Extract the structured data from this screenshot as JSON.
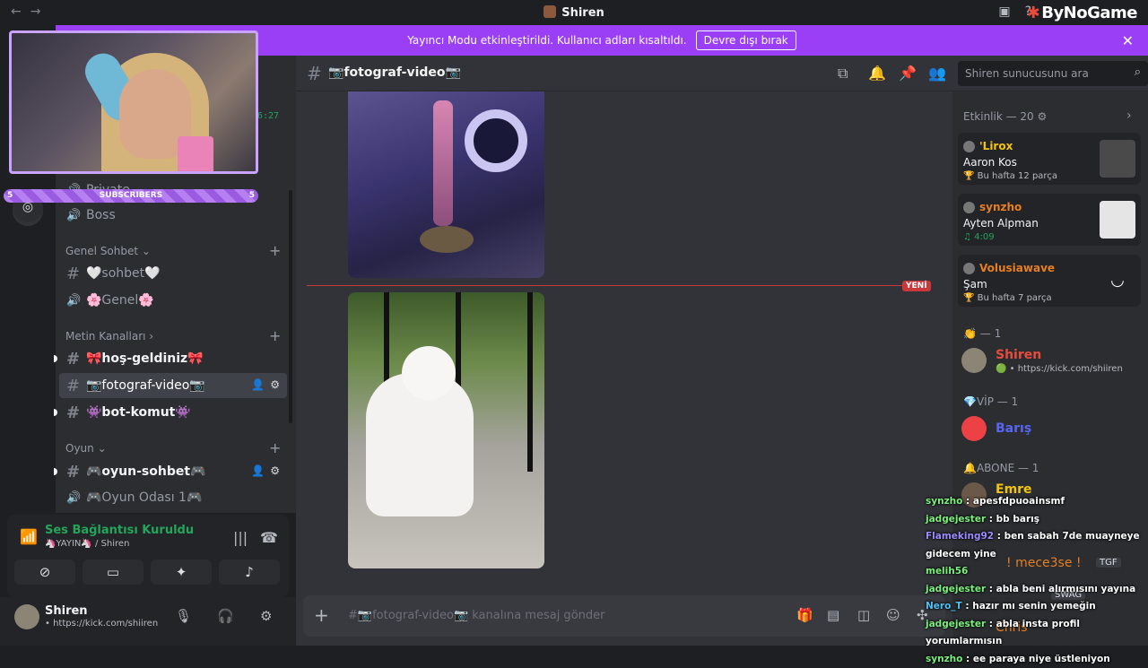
{
  "window": {
    "title": "Shiren",
    "brand": "ByNoGame"
  },
  "banner": {
    "text": "Yayıncı Modu etkinleştirildi. Kullanıcı adları kısaltıldı.",
    "button": "Devre dışı bırak"
  },
  "overlay": {
    "subscribers_label": "SUBSCRIBERS",
    "sub_left": "5",
    "sub_right": "5",
    "clock_fragment": "6:27"
  },
  "sidebar": {
    "channels": [
      {
        "name": "Private",
        "type": "voice"
      },
      {
        "name": "Boss",
        "type": "voice"
      }
    ],
    "categories": [
      {
        "label": "Genel Sohbet ⌄"
      },
      {
        "label": "Metin Kanalları ›"
      },
      {
        "label": "Oyun ⌄"
      }
    ],
    "genel": [
      {
        "name": "🤍sohbet🤍",
        "type": "text"
      },
      {
        "name": "🌸Genel🌸",
        "type": "voice"
      }
    ],
    "metin": [
      {
        "name": "🎀hoş-geldiniz🎀",
        "type": "text",
        "unread": true
      },
      {
        "name": "📷fotograf-video📷",
        "type": "text",
        "active": true
      },
      {
        "name": "👾bot-komut👾",
        "type": "text",
        "unread": true
      }
    ],
    "oyun": [
      {
        "name": "🎮oyun-sohbet🎮",
        "type": "text",
        "unread": true
      },
      {
        "name": "🎮Oyun Odası 1🎮",
        "type": "voice"
      }
    ]
  },
  "voice": {
    "status": "Ses Bağlantısı Kuruldu",
    "channel": "🦄YAYIN🦄 / Shiren"
  },
  "user": {
    "name": "Shiren",
    "status": "• https://kick.com/shiiren"
  },
  "channel_header": {
    "name": "📷fotograf-video📷",
    "search_placeholder": "Shiren sunucusunu ara"
  },
  "messages": {
    "new_tag": "YENİ"
  },
  "composer": {
    "placeholder": "#📷fotograf-video📷 kanalına mesaj gönder"
  },
  "members": {
    "activity_header": "Etkinlik — 20 ⚙",
    "activities": [
      {
        "user": "'Lirox",
        "color": "#f1c40f",
        "line1": "Aaron Kos",
        "line2": "🏆 Bu hafta 12 parça",
        "art": "#444"
      },
      {
        "user": "synzho",
        "color": "#e67e22",
        "line1": "Ayten Alpman",
        "line2": "♫ 4:09",
        "art": "#ddd"
      },
      {
        "user": "Volusiawave",
        "color": "#e67e22",
        "line1": "Şam",
        "line2": "🏆 Bu hafta 7 parça",
        "art": "#2b2d31"
      }
    ],
    "groups": [
      {
        "header": "👏 — 1",
        "name": "Shiren",
        "name_color": "#e74c3c",
        "sub": "🟢 • https://kick.com/shiiren"
      },
      {
        "header": "💎VİP — 1",
        "name": "Barış",
        "name_color": "#5865f2",
        "sub": ""
      },
      {
        "header": "🔔ABONE — 1",
        "name": "Emre",
        "name_color": "#f1c40f",
        "sub": ""
      }
    ],
    "extra": [
      "! mece3se !",
      "TGF",
      "SWAG",
      "Chris"
    ]
  },
  "chat": [
    {
      "user": "synzho",
      "cls": "",
      "msg": ": apesfdpuoainsmf"
    },
    {
      "user": "jadgejester",
      "cls": "",
      "msg": ": bb barış"
    },
    {
      "user": "Flameking92",
      "cls": "p",
      "msg": ": ben sabah 7de muayneye gidecem yine"
    },
    {
      "user": "melih56",
      "cls": "",
      "msg": ""
    },
    {
      "user": "jadgejester",
      "cls": "",
      "msg": ": abla beni alırmısını yayına"
    },
    {
      "user": "Nero_T",
      "cls": "c",
      "msg": ": hazır mı senin yemeğin"
    },
    {
      "user": "jadgejester",
      "cls": "",
      "msg": ": abla insta profil yorumlarmısın"
    },
    {
      "user": "synzho",
      "cls": "",
      "msg": ": ee paraya niye üstleniyon"
    }
  ]
}
